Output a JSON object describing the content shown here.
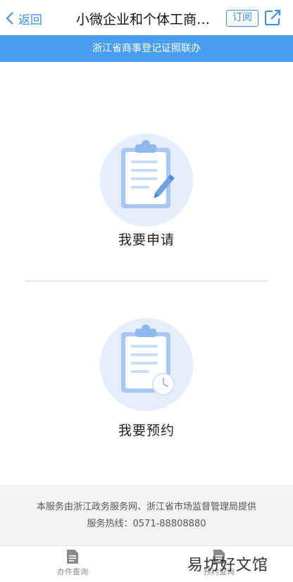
{
  "nav": {
    "back_label": "返回",
    "title": "小微企业和个体工商…",
    "subscribe_label": "订阅",
    "share_icon": "share-icon"
  },
  "banner": {
    "text": "浙江省商事登记证照联办"
  },
  "cards": [
    {
      "label": "我要申请",
      "icon": "clipboard-pencil-icon"
    },
    {
      "label": "我要预约",
      "icon": "clipboard-clock-icon"
    }
  ],
  "footer": {
    "line1": "本服务由浙江政务服务网、浙江省市场监督管理局提供",
    "line2": "服务热线：0571-88808880"
  },
  "tabbar": {
    "items": [
      {
        "label": "办件查询",
        "icon": "document-icon"
      },
      {
        "label": "预约查询",
        "icon": "document-icon"
      }
    ]
  },
  "watermark": "易坊好文馆",
  "colors": {
    "accent": "#3a8ee6",
    "banner": "#4a9ef2",
    "icon_circle": "#e4eefb",
    "icon_blue": "#8fb8ec"
  }
}
